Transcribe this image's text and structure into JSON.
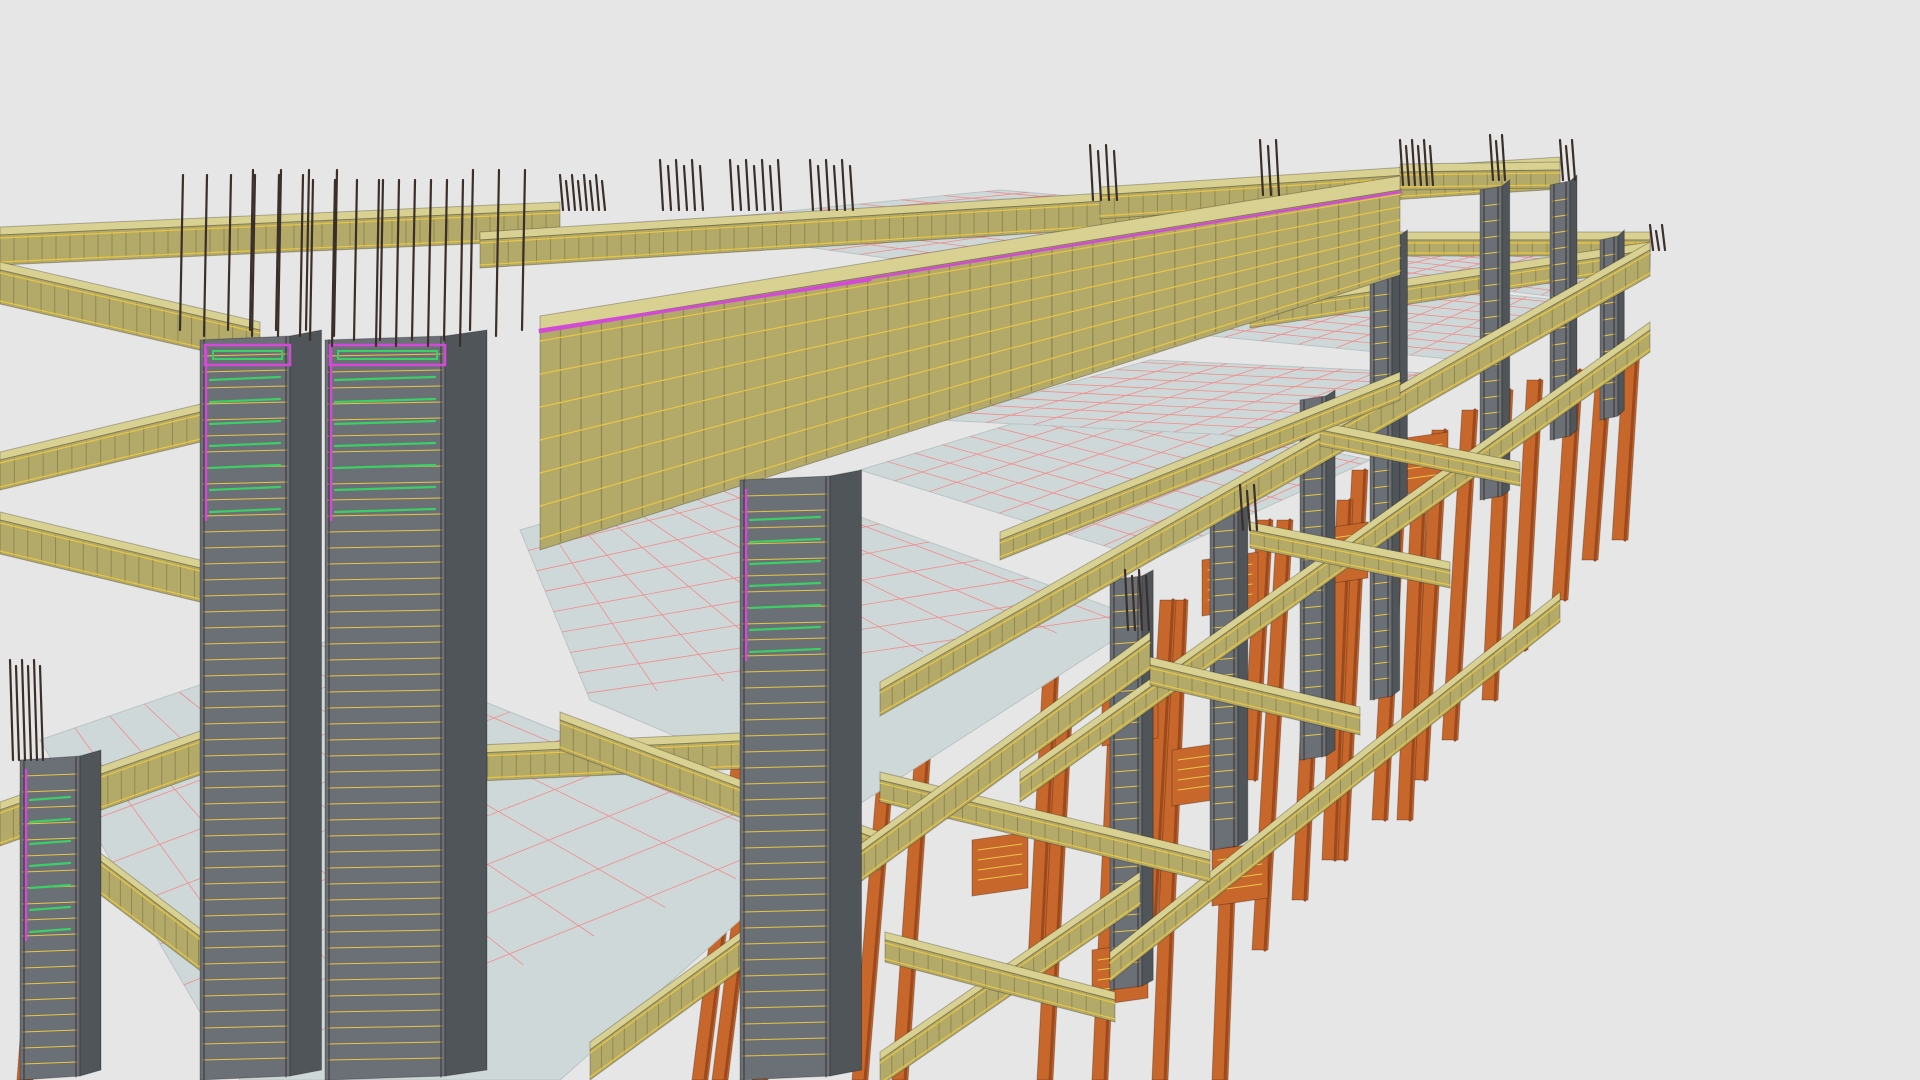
{
  "viewport": {
    "background": "#e6e6e6"
  },
  "palette": {
    "slab": "#cfd8d8",
    "slab_edge": "#b9c4c4",
    "beam_top": "#d9d191",
    "beam_side": "#b3aa69",
    "beam_dark": "#8f8751",
    "column_face": "#6a7076",
    "column_side": "#505559",
    "pile": "#c8672c",
    "pile_dark": "#9c4a1d",
    "rebar_dark": "#3b2f2a",
    "rebar_yellow": "#e8c545",
    "rebar_magenta": "#d24bd6",
    "rebar_green": "#3ccf66",
    "rebar_pink": "#f08d8d"
  }
}
